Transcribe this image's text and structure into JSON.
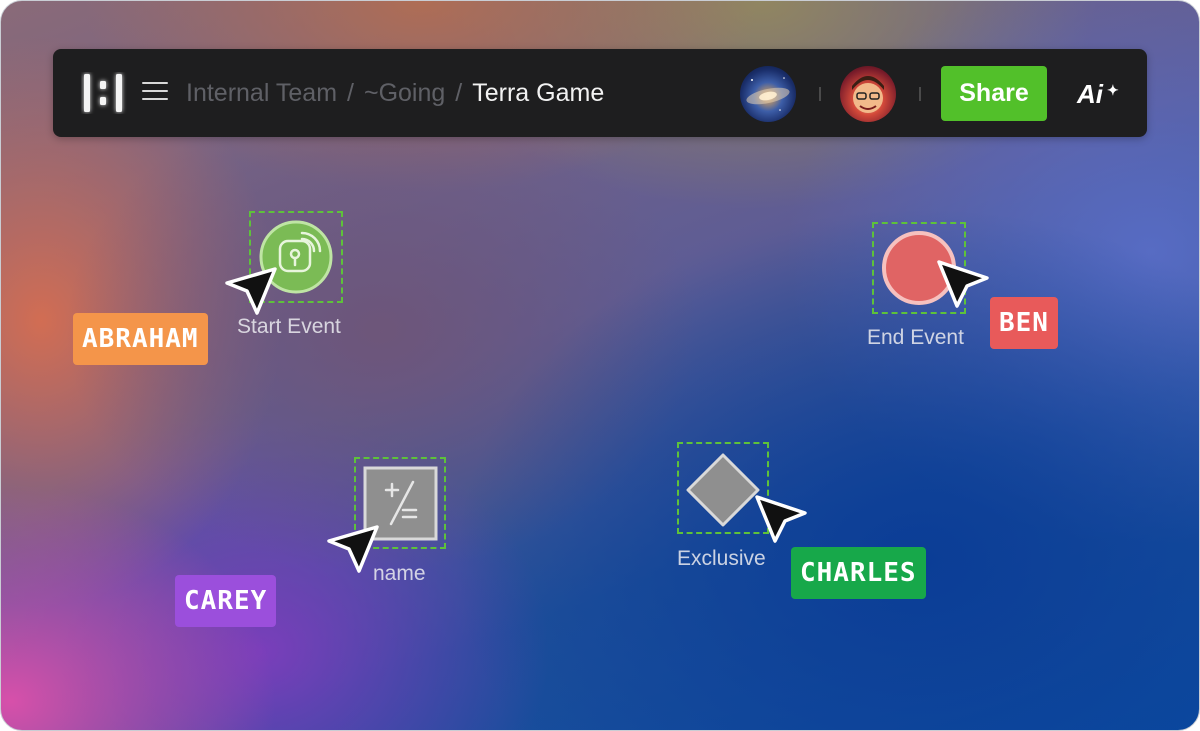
{
  "breadcrumb": {
    "items": [
      "Internal Team",
      "~Going"
    ],
    "separator": "/",
    "current": "Terra Game"
  },
  "toolbar": {
    "share_label": "Share",
    "ai_label": "Ai",
    "ai_spark": "✦",
    "share_color": "#52c02a"
  },
  "nodes": {
    "start": {
      "label": "Start Event",
      "icon": "fingerprint-lock-icon",
      "color": "#7bbb55"
    },
    "end": {
      "label": "End Event",
      "color": "#e06464"
    },
    "task": {
      "label": "name",
      "icon": "plus-minus-equals-icon"
    },
    "gateway": {
      "label": "Exclusive"
    }
  },
  "collaborators": [
    {
      "name": "ABRAHAM",
      "color": "#f4954a"
    },
    {
      "name": "BEN",
      "color": "#e85a5a"
    },
    {
      "name": "CAREY",
      "color": "#9b4fdc"
    },
    {
      "name": "CHARLES",
      "color": "#17a84a"
    }
  ],
  "selection_color": "#5ec23a"
}
